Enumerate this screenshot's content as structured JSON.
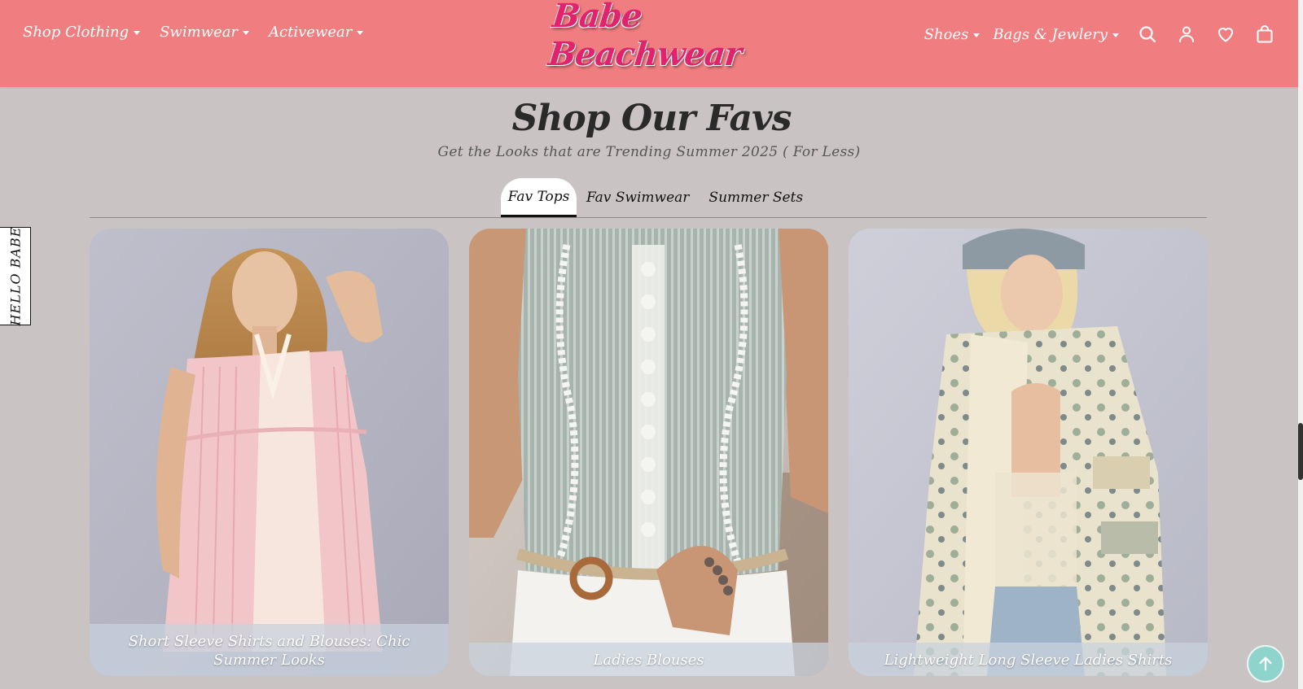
{
  "brand": {
    "logo_text": "Babe Beachwear",
    "logo_color": "#e0236c",
    "header_color": "#f07e80"
  },
  "nav_left": [
    {
      "label": "Shop Clothing"
    },
    {
      "label": "Swimwear"
    },
    {
      "label": "Activewear"
    }
  ],
  "nav_right": [
    {
      "label": "Shoes"
    },
    {
      "label": "Bags & Jewlery"
    }
  ],
  "header_icons": [
    "search-icon",
    "account-icon",
    "wishlist-heart-icon",
    "cart-bag-icon"
  ],
  "section": {
    "title": "Shop Our Favs",
    "subtitle": "Get the Looks that are Trending Summer 2025 ( For Less)"
  },
  "tabs": [
    {
      "label": "Fav Tops",
      "active": true
    },
    {
      "label": "Fav Swimwear",
      "active": false
    },
    {
      "label": "Summer Sets",
      "active": false
    }
  ],
  "cards": [
    {
      "caption": "Short Sleeve Shirts and Blouses: Chic Summer Looks"
    },
    {
      "caption": "Ladies Blouses"
    },
    {
      "caption": "Lightweight Long Sleeve Ladies Shirts"
    }
  ],
  "side_tab": {
    "label": "HELLO BABE"
  },
  "back_to_top_icon": "arrow-up-icon",
  "back_to_top_color": "#8fd4cc"
}
